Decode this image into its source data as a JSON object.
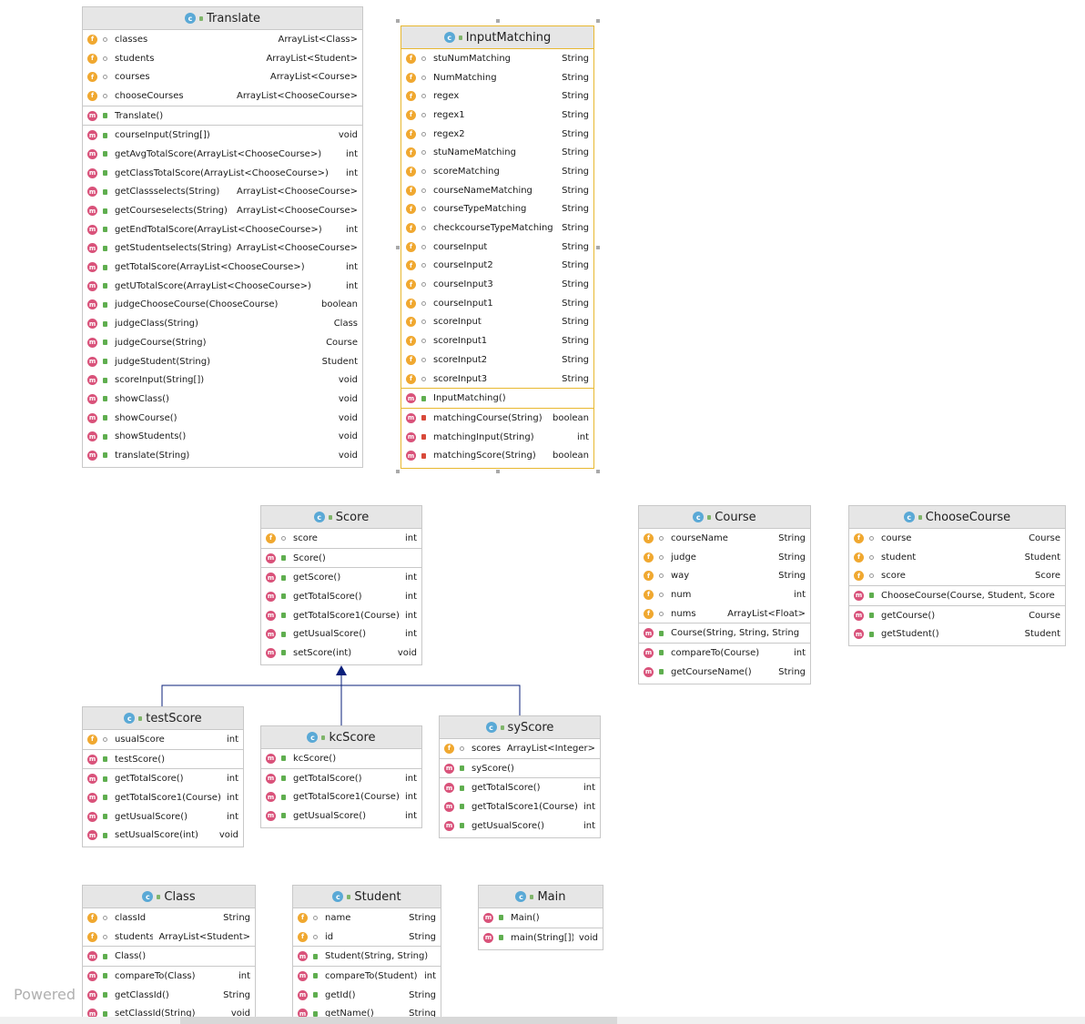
{
  "classes": {
    "translate": {
      "title": "Translate",
      "fields": [
        {
          "name": "classes",
          "type": "ArrayList<Class>"
        },
        {
          "name": "students",
          "type": "ArrayList<Student>"
        },
        {
          "name": "courses",
          "type": "ArrayList<Course>"
        },
        {
          "name": "chooseCourses",
          "type": "ArrayList<ChooseCourse>"
        }
      ],
      "constructors": [
        {
          "name": "Translate()",
          "type": ""
        }
      ],
      "methods": [
        {
          "name": "courseInput(String[])",
          "type": "void"
        },
        {
          "name": "getAvgTotalScore(ArrayList<ChooseCourse>)",
          "type": "int"
        },
        {
          "name": "getClassTotalScore(ArrayList<ChooseCourse>)",
          "type": "int"
        },
        {
          "name": "getClassselects(String)",
          "type": "ArrayList<ChooseCourse>"
        },
        {
          "name": "getCourseselects(String)",
          "type": "ArrayList<ChooseCourse>"
        },
        {
          "name": "getEndTotalScore(ArrayList<ChooseCourse>)",
          "type": "int"
        },
        {
          "name": "getStudentselects(String)",
          "type": "ArrayList<ChooseCourse>"
        },
        {
          "name": "getTotalScore(ArrayList<ChooseCourse>)",
          "type": "int"
        },
        {
          "name": "getUTotalScore(ArrayList<ChooseCourse>)",
          "type": "int"
        },
        {
          "name": "judgeChooseCourse(ChooseCourse)",
          "type": "boolean"
        },
        {
          "name": "judgeClass(String)",
          "type": "Class"
        },
        {
          "name": "judgeCourse(String)",
          "type": "Course"
        },
        {
          "name": "judgeStudent(String)",
          "type": "Student"
        },
        {
          "name": "scoreInput(String[])",
          "type": "void"
        },
        {
          "name": "showClass()",
          "type": "void"
        },
        {
          "name": "showCourse()",
          "type": "void"
        },
        {
          "name": "showStudents()",
          "type": "void"
        },
        {
          "name": "translate(String)",
          "type": "void"
        }
      ]
    },
    "inputMatching": {
      "title": "InputMatching",
      "fields": [
        {
          "name": "stuNumMatching",
          "type": "String"
        },
        {
          "name": "NumMatching",
          "type": "String"
        },
        {
          "name": "regex",
          "type": "String"
        },
        {
          "name": "regex1",
          "type": "String"
        },
        {
          "name": "regex2",
          "type": "String"
        },
        {
          "name": "stuNameMatching",
          "type": "String"
        },
        {
          "name": "scoreMatching",
          "type": "String"
        },
        {
          "name": "courseNameMatching",
          "type": "String"
        },
        {
          "name": "courseTypeMatching",
          "type": "String"
        },
        {
          "name": "checkcourseTypeMatching",
          "type": "String"
        },
        {
          "name": "courseInput",
          "type": "String"
        },
        {
          "name": "courseInput2",
          "type": "String"
        },
        {
          "name": "courseInput3",
          "type": "String"
        },
        {
          "name": "courseInput1",
          "type": "String"
        },
        {
          "name": "scoreInput",
          "type": "String"
        },
        {
          "name": "scoreInput1",
          "type": "String"
        },
        {
          "name": "scoreInput2",
          "type": "String"
        },
        {
          "name": "scoreInput3",
          "type": "String"
        }
      ],
      "constructors": [
        {
          "name": "InputMatching()",
          "type": ""
        }
      ],
      "methods": [
        {
          "name": "matchingCourse(String)",
          "type": "boolean"
        },
        {
          "name": "matchingInput(String)",
          "type": "int"
        },
        {
          "name": "matchingScore(String)",
          "type": "boolean"
        }
      ]
    },
    "score": {
      "title": "Score",
      "fields": [
        {
          "name": "score",
          "type": "int"
        }
      ],
      "constructors": [
        {
          "name": "Score()",
          "type": ""
        }
      ],
      "methods": [
        {
          "name": "getScore()",
          "type": "int"
        },
        {
          "name": "getTotalScore()",
          "type": "int"
        },
        {
          "name": "getTotalScore1(Course)",
          "type": "int"
        },
        {
          "name": "getUsualScore()",
          "type": "int"
        },
        {
          "name": "setScore(int)",
          "type": "void"
        }
      ]
    },
    "course": {
      "title": "Course",
      "fields": [
        {
          "name": "courseName",
          "type": "String"
        },
        {
          "name": "judge",
          "type": "String"
        },
        {
          "name": "way",
          "type": "String"
        },
        {
          "name": "num",
          "type": "int"
        },
        {
          "name": "nums",
          "type": "ArrayList<Float>"
        }
      ],
      "constructors": [
        {
          "name": "Course(String, String, String)",
          "type": ""
        }
      ],
      "methods": [
        {
          "name": "compareTo(Course)",
          "type": "int"
        },
        {
          "name": "getCourseName()",
          "type": "String"
        }
      ]
    },
    "chooseCourse": {
      "title": "ChooseCourse",
      "fields": [
        {
          "name": "course",
          "type": "Course"
        },
        {
          "name": "student",
          "type": "Student"
        },
        {
          "name": "score",
          "type": "Score"
        }
      ],
      "constructors": [
        {
          "name": "ChooseCourse(Course, Student, Score)",
          "type": ""
        }
      ],
      "methods": [
        {
          "name": "getCourse()",
          "type": "Course"
        },
        {
          "name": "getStudent()",
          "type": "Student"
        }
      ]
    },
    "testScore": {
      "title": "testScore",
      "fields": [
        {
          "name": "usualScore",
          "type": "int"
        }
      ],
      "constructors": [
        {
          "name": "testScore()",
          "type": ""
        }
      ],
      "methods": [
        {
          "name": "getTotalScore()",
          "type": "int"
        },
        {
          "name": "getTotalScore1(Course)",
          "type": "int"
        },
        {
          "name": "getUsualScore()",
          "type": "int"
        },
        {
          "name": "setUsualScore(int)",
          "type": "void"
        }
      ]
    },
    "kcScore": {
      "title": "kcScore",
      "fields": [],
      "constructors": [
        {
          "name": "kcScore()",
          "type": ""
        }
      ],
      "methods": [
        {
          "name": "getTotalScore()",
          "type": "int"
        },
        {
          "name": "getTotalScore1(Course)",
          "type": "int"
        },
        {
          "name": "getUsualScore()",
          "type": "int"
        }
      ]
    },
    "syScore": {
      "title": "syScore",
      "fields": [
        {
          "name": "scores",
          "type": "ArrayList<Integer>"
        }
      ],
      "constructors": [
        {
          "name": "syScore()",
          "type": ""
        }
      ],
      "methods": [
        {
          "name": "getTotalScore()",
          "type": "int"
        },
        {
          "name": "getTotalScore1(Course)",
          "type": "int"
        },
        {
          "name": "getUsualScore()",
          "type": "int"
        }
      ]
    },
    "class": {
      "title": "Class",
      "fields": [
        {
          "name": "classId",
          "type": "String"
        },
        {
          "name": "students",
          "type": "ArrayList<Student>"
        }
      ],
      "constructors": [
        {
          "name": "Class()",
          "type": ""
        }
      ],
      "methods": [
        {
          "name": "compareTo(Class)",
          "type": "int"
        },
        {
          "name": "getClassId()",
          "type": "String"
        },
        {
          "name": "setClassId(String)",
          "type": "void"
        }
      ]
    },
    "student": {
      "title": "Student",
      "fields": [
        {
          "name": "name",
          "type": "String"
        },
        {
          "name": "id",
          "type": "String"
        }
      ],
      "constructors": [
        {
          "name": "Student(String, String)",
          "type": ""
        }
      ],
      "methods": [
        {
          "name": "compareTo(Student)",
          "type": "int"
        },
        {
          "name": "getId()",
          "type": "String"
        },
        {
          "name": "getName()",
          "type": "String"
        }
      ]
    },
    "main": {
      "title": "Main",
      "fields": [],
      "constructors": [
        {
          "name": "Main()",
          "type": ""
        }
      ],
      "methods": [
        {
          "name": "main(String[])",
          "type": "void"
        }
      ]
    }
  },
  "footer": {
    "powered": "Powered"
  },
  "colors": {
    "field_icon": "#f0a830",
    "method_icon": "#d9527a",
    "class_icon": "#5aa9d6",
    "selection": "#e8b830",
    "arrow": "#0a1f7a"
  }
}
